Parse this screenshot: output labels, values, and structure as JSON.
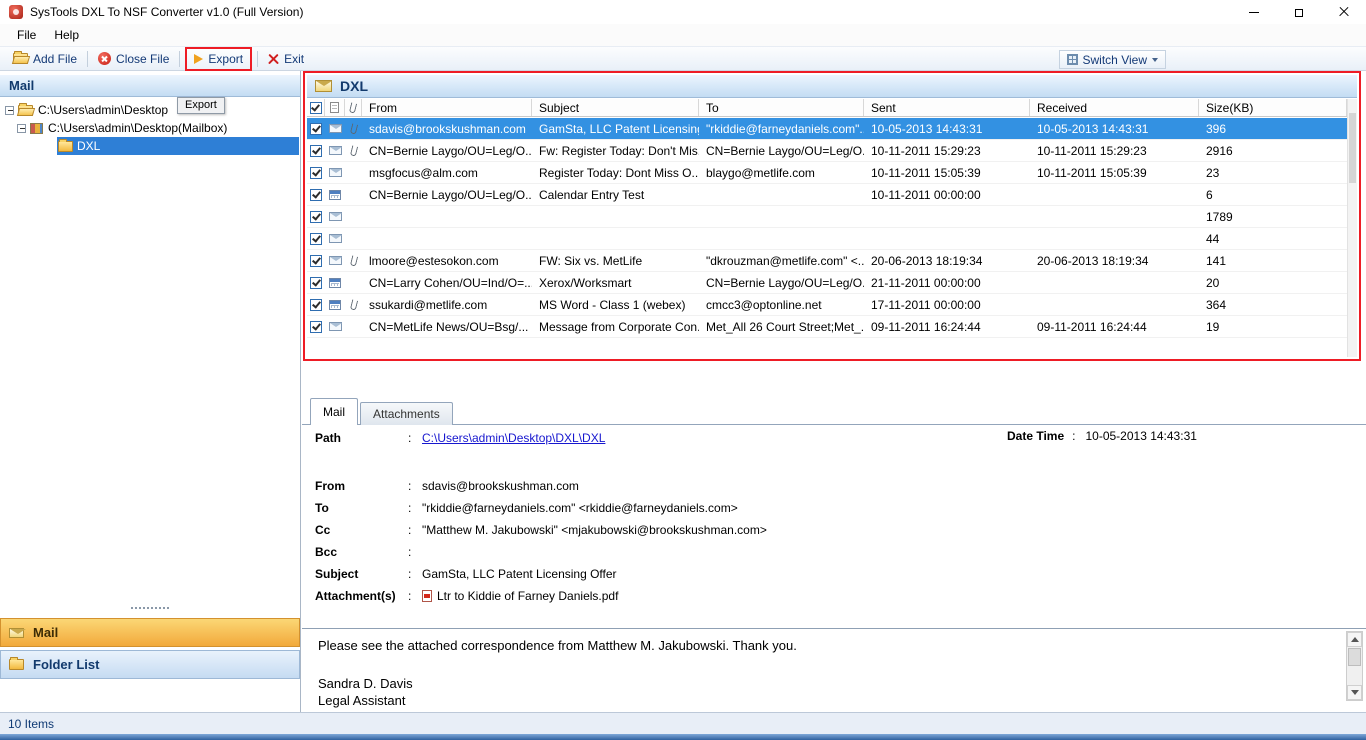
{
  "window": {
    "title": "SysTools DXL To NSF Converter v1.0 (Full Version)"
  },
  "menu": {
    "items": [
      "File",
      "Help"
    ]
  },
  "toolbar": {
    "add_file": "Add File",
    "close_file": "Close File",
    "export": "Export",
    "exit": "Exit",
    "switch_view": "Switch View",
    "export_tooltip": "Export"
  },
  "sidebar": {
    "header": "Mail",
    "tree": [
      {
        "label": "C:\\Users\\admin\\Desktop",
        "state": ""
      },
      {
        "label": "C:\\Users\\admin\\Desktop(Mailbox)",
        "state": ""
      },
      {
        "label": "DXL",
        "state": "selected"
      }
    ],
    "nav": [
      {
        "label": "Mail",
        "active": true
      },
      {
        "label": "Folder List",
        "active": false
      }
    ]
  },
  "statusbar": {
    "items_count": "10 Items"
  },
  "list": {
    "title": "DXL",
    "select_all_checked": true,
    "columns": [
      "From",
      "Subject",
      "To",
      "Sent",
      "Received",
      "Size(KB)"
    ],
    "rows": [
      {
        "checked": true,
        "state": "selected",
        "icon": "envelope",
        "attach": true,
        "from": "sdavis@brookskushman.com",
        "subject": "GamSta, LLC Patent Licensing...",
        "to": "\"rkiddie@farneydaniels.com\"...",
        "sent": "10-05-2013 14:43:31",
        "received": "10-05-2013 14:43:31",
        "size": "396"
      },
      {
        "checked": true,
        "state": "",
        "icon": "envelope",
        "attach": true,
        "from": "CN=Bernie Laygo/OU=Leg/O...",
        "subject": "Fw: Register Today: Don't Mis...",
        "to": "CN=Bernie Laygo/OU=Leg/O...",
        "sent": "10-11-2011 15:29:23",
        "received": "10-11-2011 15:29:23",
        "size": "2916"
      },
      {
        "checked": true,
        "state": "",
        "icon": "envelope",
        "attach": false,
        "from": "msgfocus@alm.com",
        "subject": "Register Today: Dont Miss O...",
        "to": "blaygo@metlife.com",
        "sent": "10-11-2011 15:05:39",
        "received": "10-11-2011 15:05:39",
        "size": "23"
      },
      {
        "checked": true,
        "state": "",
        "icon": "calendar",
        "attach": false,
        "from": "CN=Bernie Laygo/OU=Leg/O...",
        "subject": "Calendar Entry Test",
        "to": "",
        "sent": "10-11-2011 00:00:00",
        "received": "",
        "size": "6"
      },
      {
        "checked": true,
        "state": "",
        "icon": "envelope",
        "attach": false,
        "from": "",
        "subject": "",
        "to": "",
        "sent": "",
        "received": "",
        "size": "1789"
      },
      {
        "checked": true,
        "state": "",
        "icon": "envelope",
        "attach": false,
        "from": "",
        "subject": "",
        "to": "",
        "sent": "",
        "received": "",
        "size": "44"
      },
      {
        "checked": true,
        "state": "",
        "icon": "envelope",
        "attach": true,
        "from": "lmoore@estesokon.com",
        "subject": "FW: Six vs. MetLife",
        "to": "\"dkrouzman@metlife.com\" <...",
        "sent": "20-06-2013 18:19:34",
        "received": "20-06-2013 18:19:34",
        "size": "141"
      },
      {
        "checked": true,
        "state": "",
        "icon": "calendar",
        "attach": false,
        "from": "CN=Larry Cohen/OU=Ind/O=...",
        "subject": "Xerox/Worksmart",
        "to": "CN=Bernie Laygo/OU=Leg/O...",
        "sent": "21-11-2011 00:00:00",
        "received": "",
        "size": "20"
      },
      {
        "checked": true,
        "state": "",
        "icon": "calendar",
        "attach": true,
        "from": "ssukardi@metlife.com",
        "subject": "MS Word - Class 1 (webex)",
        "to": "cmcc3@optonline.net",
        "sent": "17-11-2011 00:00:00",
        "received": "",
        "size": "364"
      },
      {
        "checked": true,
        "state": "",
        "icon": "envelope",
        "attach": false,
        "from": "CN=MetLife News/OU=Bsg/...",
        "subject": "Message from Corporate Con...",
        "to": "Met_All 26 Court Street;Met_...",
        "sent": "09-11-2011 16:24:44",
        "received": "09-11-2011 16:24:44",
        "size": "19"
      }
    ]
  },
  "preview": {
    "tabs": [
      {
        "label": "Mail",
        "state": "active"
      },
      {
        "label": "Attachments",
        "state": "inactive"
      }
    ],
    "colon": ":",
    "path_label": "Path",
    "path_value": "C:\\Users\\admin\\Desktop\\DXL\\DXL",
    "datetime_label": "Date Time",
    "datetime_value": "10-05-2013 14:43:31",
    "fields": [
      {
        "label": "From",
        "value": "sdavis@brookskushman.com"
      },
      {
        "label": "To",
        "value": "\"rkiddie@farneydaniels.com\" <rkiddie@farneydaniels.com>"
      },
      {
        "label": "Cc",
        "value": "\"Matthew M. Jakubowski\" <mjakubowski@brookskushman.com>"
      },
      {
        "label": "Bcc",
        "value": ""
      },
      {
        "label": "Subject",
        "value": "GamSta, LLC Patent Licensing Offer"
      },
      {
        "label": "Attachment(s)",
        "value": "Ltr to Kiddie of Farney Daniels.pdf"
      }
    ],
    "body": [
      "Please see the attached correspondence from Matthew M. Jakubowski.  Thank you.",
      "Sandra D. Davis",
      "Legal Assistant"
    ]
  },
  "colors": {
    "annotation_red": "#ee1c25",
    "selection_blue": "#3391e2",
    "nav_active_orange": "#f2a93b",
    "header_blue": "#c3dcf3",
    "link_blue": "#1717cf"
  }
}
